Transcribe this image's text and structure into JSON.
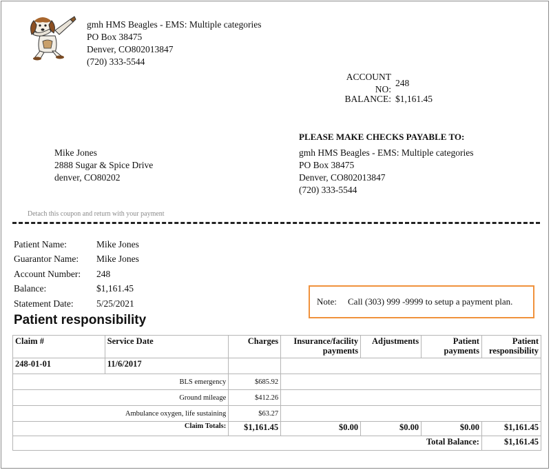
{
  "company": {
    "name": "gmh HMS Beagles - EMS: Multiple categories",
    "address1": "PO Box 38475",
    "address2": "Denver, CO802013847",
    "phone": "(720) 333-5544"
  },
  "account": {
    "account_no_label": "ACCOUNT NO:",
    "account_no": "248",
    "balance_label": "BALANCE:",
    "balance": "$1,161.45"
  },
  "payable": {
    "heading": "PLEASE MAKE CHECKS PAYABLE TO:",
    "name": "gmh HMS Beagles - EMS: Multiple categories",
    "address1": "PO Box 38475",
    "address2": "Denver, CO802013847",
    "phone": "(720) 333-5544"
  },
  "customer": {
    "name": "Mike Jones",
    "address1": "2888 Sugar & Spice Drive",
    "address2": "denver, CO80202"
  },
  "detach_text": "Detach this coupon and return with your payment",
  "patient_info": [
    {
      "label": "Patient Name:",
      "value": "Mike Jones"
    },
    {
      "label": "Guarantor Name:",
      "value": "Mike Jones"
    },
    {
      "label": "Account Number:",
      "value": "248"
    },
    {
      "label": "Balance:",
      "value": "$1,161.45"
    },
    {
      "label": "Statement Date:",
      "value": "5/25/2021"
    }
  ],
  "note": {
    "label": "Note:",
    "text": "Call (303) 999 -9999 to setup a payment plan."
  },
  "section_title": "Patient responsibility",
  "table": {
    "headers": {
      "claim": "Claim #",
      "service_date": "Service Date",
      "charges": "Charges",
      "insurance": "Insurance/facility payments",
      "adjustments": "Adjustments",
      "patient_payments": "Patient payments",
      "patient_responsibility": "Patient responsibility"
    },
    "claim": {
      "number": "248-01-01",
      "service_date": "11/6/2017"
    },
    "items": [
      {
        "description": "BLS emergency",
        "charge": "$685.92"
      },
      {
        "description": "Ground mileage",
        "charge": "$412.26"
      },
      {
        "description": "Ambulance oxygen, life sustaining",
        "charge": "$63.27"
      }
    ],
    "totals": {
      "label": "Claim Totals:",
      "charges": "$1,161.45",
      "insurance": "$0.00",
      "adjustments": "$0.00",
      "patient_payments": "$0.00",
      "patient_responsibility": "$1,161.45"
    },
    "total_balance": {
      "label": "Total Balance:",
      "value": "$1,161.45"
    }
  },
  "logo_icon": "beagle-logo-icon",
  "colors": {
    "note_border": "#f0913b"
  }
}
